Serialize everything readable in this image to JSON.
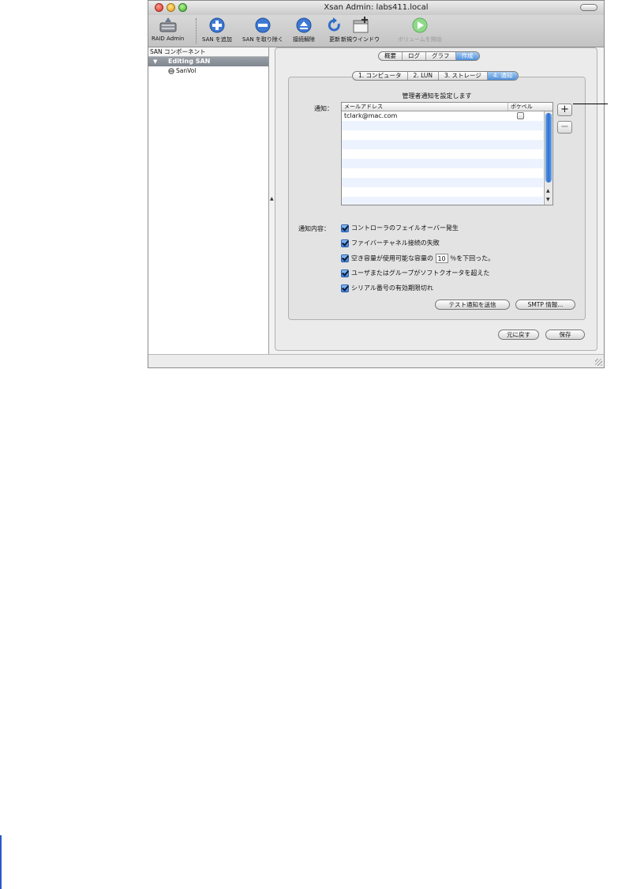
{
  "window": {
    "title": "Xsan Admin: labs411.local"
  },
  "toolbar": {
    "raid_admin": "RAID Admin",
    "add_san": "SAN を追加",
    "remove_san": "SAN を取り除く",
    "disconnect": "接続解除",
    "refresh": "更新",
    "new_window": "新規ウインドウ",
    "start_volume": "ボリュームを開始"
  },
  "sidebar": {
    "header": "SAN コンポーネント",
    "san_name": "Editing SAN",
    "volume_name": "SanVol"
  },
  "tabs": [
    "概要",
    "ログ",
    "グラフ",
    "作成"
  ],
  "steps": [
    "1. コンピュータ",
    "2. LUN",
    "3. ストレージ",
    "4. 通知"
  ],
  "panel": {
    "heading": "管理者通知を設定します",
    "notify_label": "通知：",
    "col_email": "メールアドレス",
    "col_pager": "ポケベル",
    "emails": [
      "tclark@mac.com"
    ],
    "add_symbol": "+",
    "remove_symbol": "−",
    "content_label": "通知内容：",
    "options": {
      "failover": "コントローラのフェイルオーバー発生",
      "fc_fail": "ファイバーチャネル接続の失敗",
      "space_before": "空き容量が使用可能な容量の",
      "space_value": "10",
      "space_after": "％を下回った。",
      "quota": "ユーザまたはグループがソフトクオータを超えた",
      "serial": "シリアル番号の有効期限切れ"
    },
    "test_button": "テスト通知を送信",
    "smtp_button": "SMTP 情報..."
  },
  "footer": {
    "revert": "元に戻す",
    "save": "保存"
  },
  "colors": {
    "selection_blue": "#4f8fdb",
    "sidebar_selection": "#80868f"
  }
}
